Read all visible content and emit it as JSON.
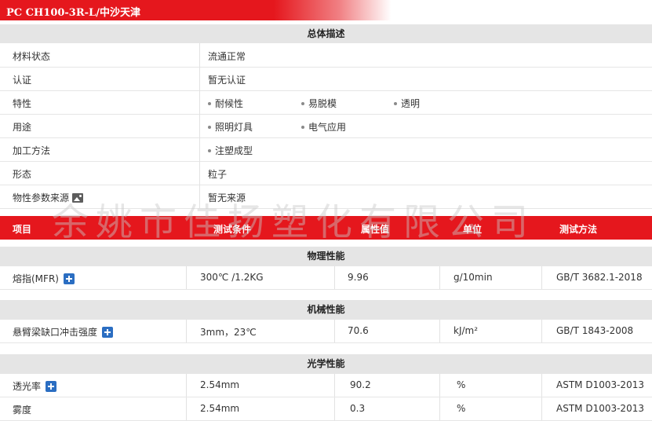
{
  "product_title": "PC CH100-3R-L/中沙天津",
  "overview": {
    "heading": "总体描述",
    "rows": [
      {
        "label": "材料状态",
        "value": "流通正常"
      },
      {
        "label": "认证",
        "value": "暂无认证"
      },
      {
        "label": "特性",
        "tags": [
          "耐候性",
          "易脱模",
          "透明"
        ]
      },
      {
        "label": "用途",
        "tags": [
          "照明灯具",
          "电气应用"
        ]
      },
      {
        "label": "加工方法",
        "tags": [
          "注塑成型"
        ]
      },
      {
        "label": "形态",
        "value": "粒子"
      },
      {
        "label": "物性参数来源",
        "value": "暂无来源",
        "icon": "image-icon"
      }
    ]
  },
  "table_header": {
    "item": "项目",
    "condition": "测试条件",
    "value": "属性值",
    "unit": "单位",
    "method": "测试方法"
  },
  "watermark": "余姚市佳扬塑化有限公司",
  "sections": [
    {
      "name": "物理性能",
      "rows": [
        {
          "item": "熔指(MFR)",
          "condition": "300℃ /1.2KG",
          "value": "9.96",
          "unit": "g/10min",
          "method": "GB/T 3682.1-2018"
        }
      ]
    },
    {
      "name": "机械性能",
      "rows": [
        {
          "item": "悬臂梁缺口冲击强度",
          "condition": "3mm，23℃",
          "value": "70.6",
          "unit": "kJ/m²",
          "method": "GB/T 1843-2008"
        }
      ]
    },
    {
      "name": "光学性能",
      "rows": [
        {
          "item": "透光率",
          "condition": "2.54mm",
          "value": "90.2",
          "unit": "%",
          "method": "ASTM D1003-2013"
        },
        {
          "item": "雾度",
          "condition": "2.54mm",
          "value": "0.3",
          "unit": "%",
          "method": "ASTM D1003-2013"
        }
      ]
    }
  ],
  "colors": {
    "accent_red": "#e5171d",
    "section_gray": "#e5e5e5",
    "plus_blue": "#2b6ec2"
  },
  "icons": {
    "expand": "plus-icon",
    "source": "image-icon"
  }
}
